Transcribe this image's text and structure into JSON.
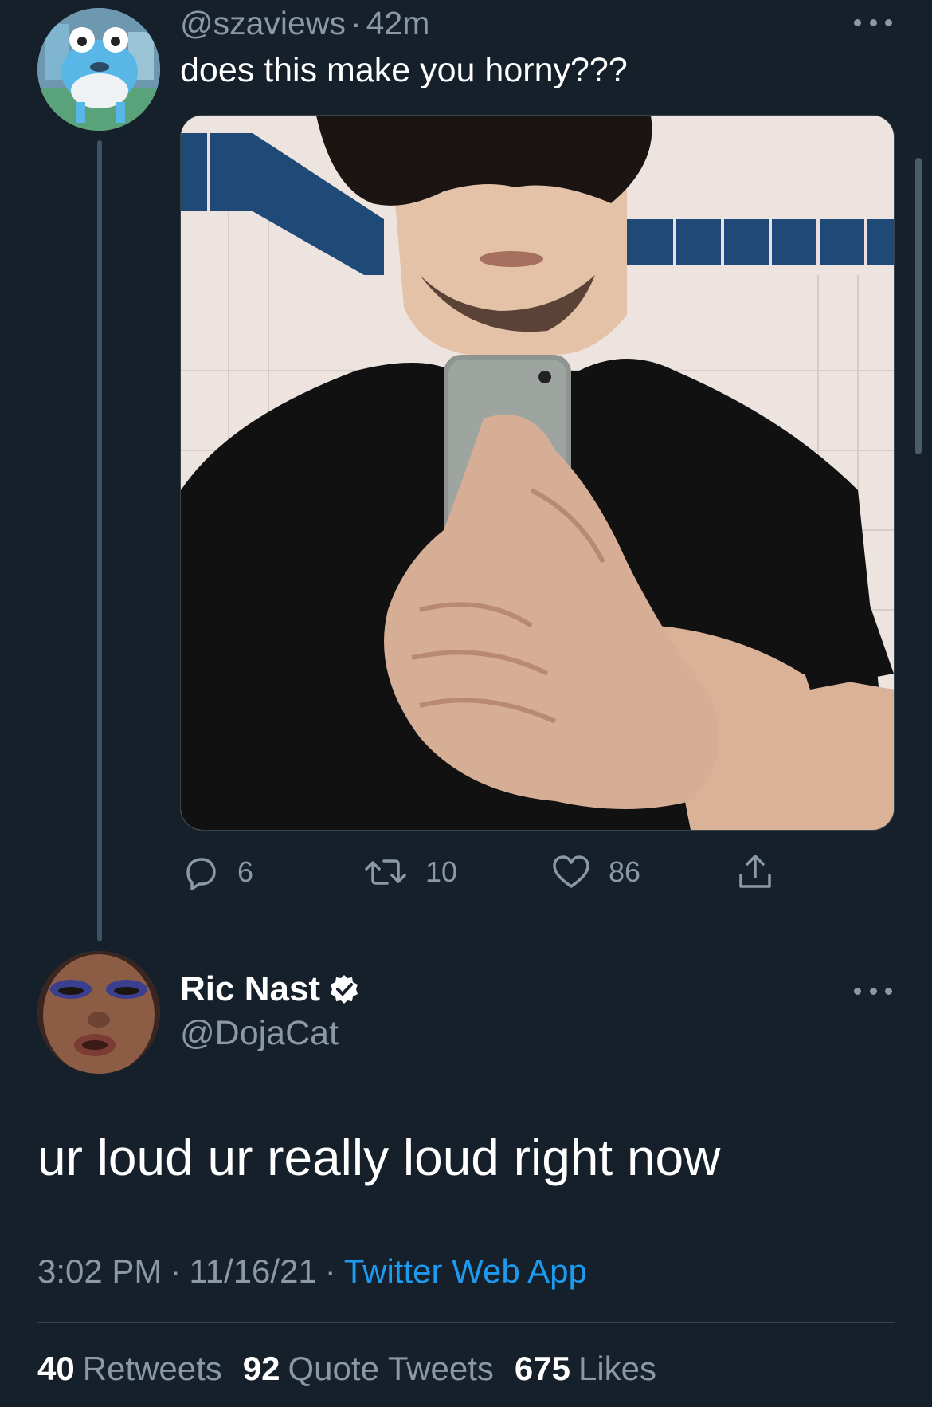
{
  "parent_tweet": {
    "handle": "@szaviews",
    "time": "42m",
    "text": "does this make you horny???",
    "avatar_icon": "cartoon-frog-avatar",
    "media_description_icon": "mirror-selfie-photo",
    "stats": {
      "replies": "6",
      "retweets": "10",
      "likes": "86"
    }
  },
  "main_tweet": {
    "display_name": "Ric Nast",
    "handle": "@DojaCat",
    "verified": true,
    "avatar_icon": "face-closeup-avatar",
    "text": "ur loud ur really loud right now",
    "time": "3:02 PM",
    "date": "11/16/21",
    "source": "Twitter Web App",
    "stats": {
      "retweets_count": "40",
      "retweets_label": "Retweets",
      "quotes_count": "92",
      "quotes_label": "Quote Tweets",
      "likes_count": "675",
      "likes_label": "Likes"
    }
  },
  "colors": {
    "background": "#15202b",
    "secondary_text": "#8b98a5",
    "link": "#1d9bf0",
    "divider": "#38444d",
    "verified_badge": "#ffffff"
  }
}
